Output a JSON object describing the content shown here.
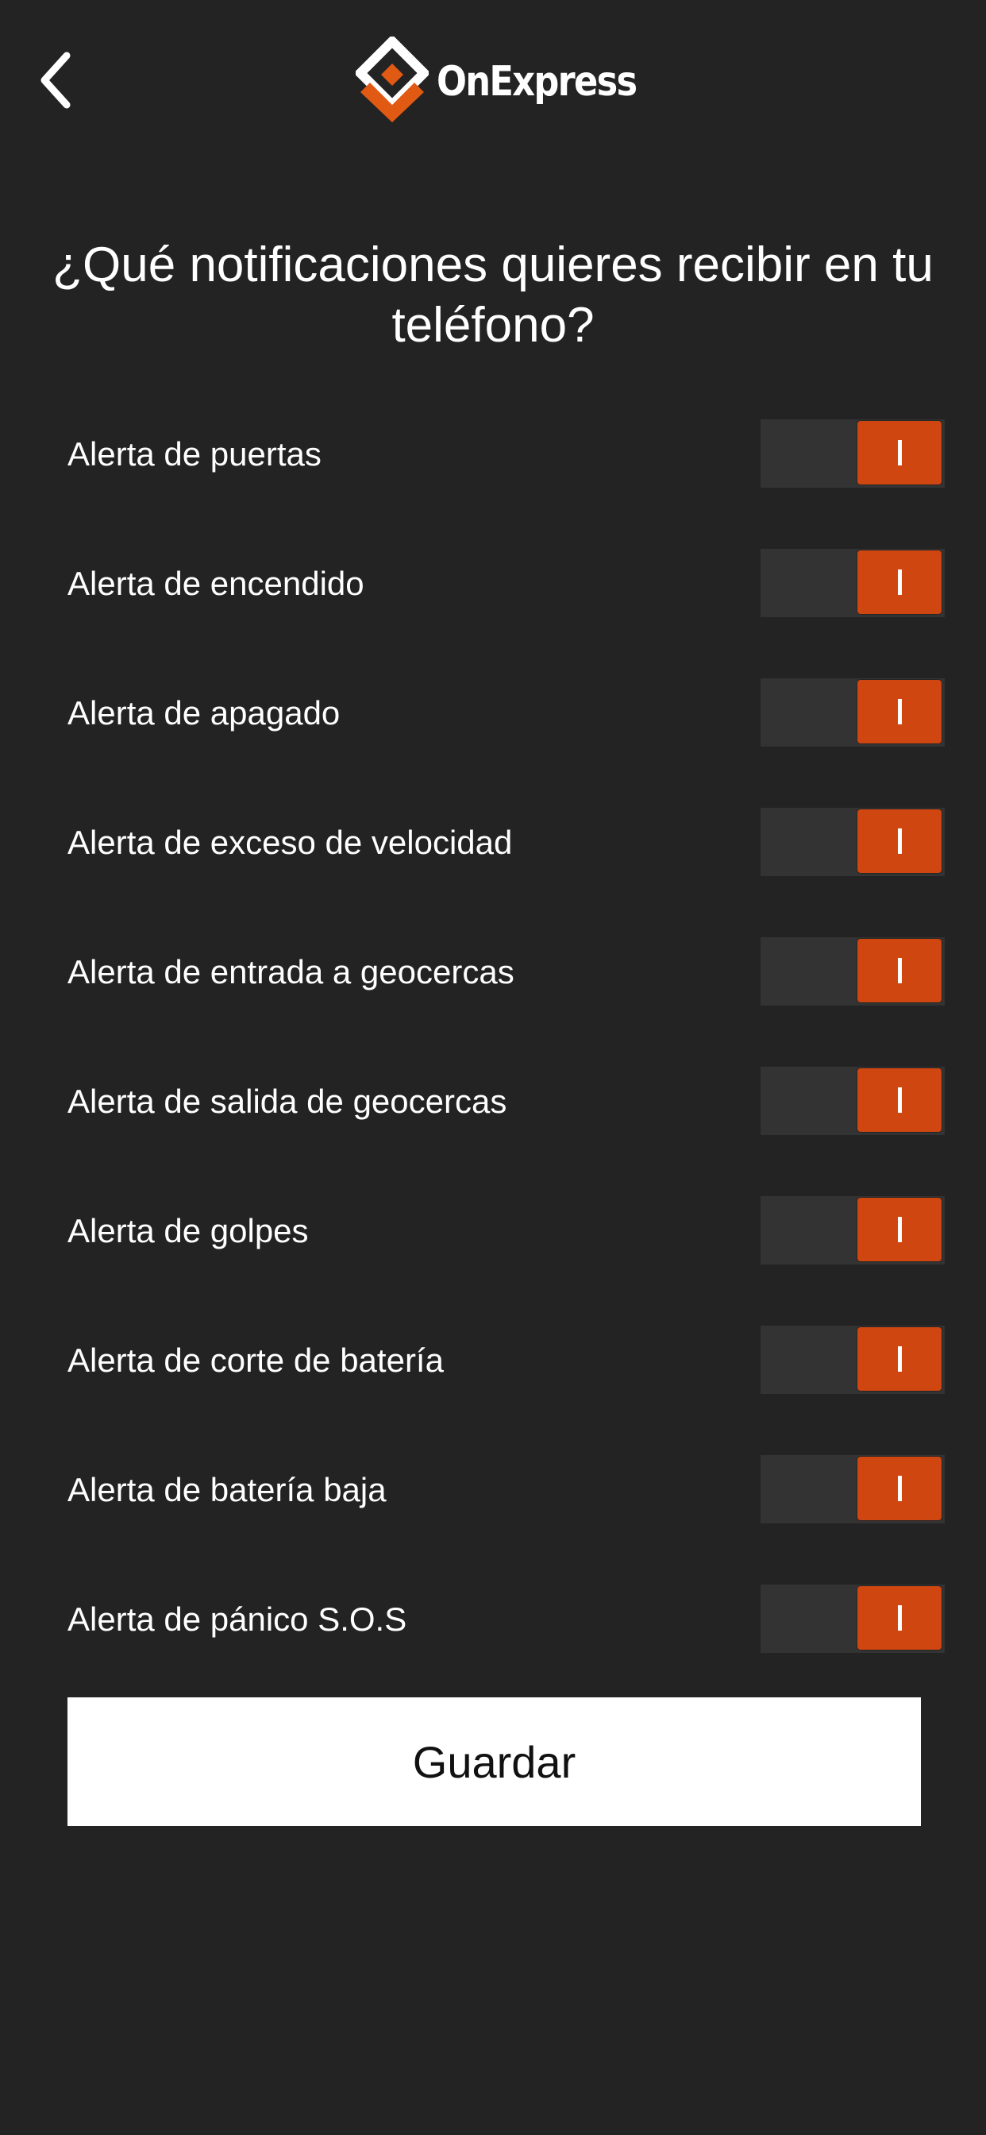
{
  "header": {
    "back_icon": "chevron-left-icon",
    "logo_text": "OnExpress",
    "brand_color": "#e05a14"
  },
  "question": "¿Qué notificaciones quieres recibir en tu teléfono?",
  "alerts": [
    {
      "label": "Alerta de puertas",
      "enabled": true
    },
    {
      "label": "Alerta de encendido",
      "enabled": true
    },
    {
      "label": "Alerta de apagado",
      "enabled": true
    },
    {
      "label": "Alerta de exceso de velocidad",
      "enabled": true
    },
    {
      "label": "Alerta de entrada a geocercas",
      "enabled": true
    },
    {
      "label": "Alerta de salida de geocercas",
      "enabled": true
    },
    {
      "label": "Alerta de golpes",
      "enabled": true
    },
    {
      "label": "Alerta de corte de batería",
      "enabled": true
    },
    {
      "label": "Alerta de batería baja",
      "enabled": true
    },
    {
      "label": "Alerta de pánico S.O.S",
      "enabled": true
    }
  ],
  "save_button": {
    "label": "Guardar"
  },
  "colors": {
    "background": "#232323",
    "toggle_track": "#333333",
    "toggle_on": "#d04610",
    "button_bg": "#ffffff"
  }
}
